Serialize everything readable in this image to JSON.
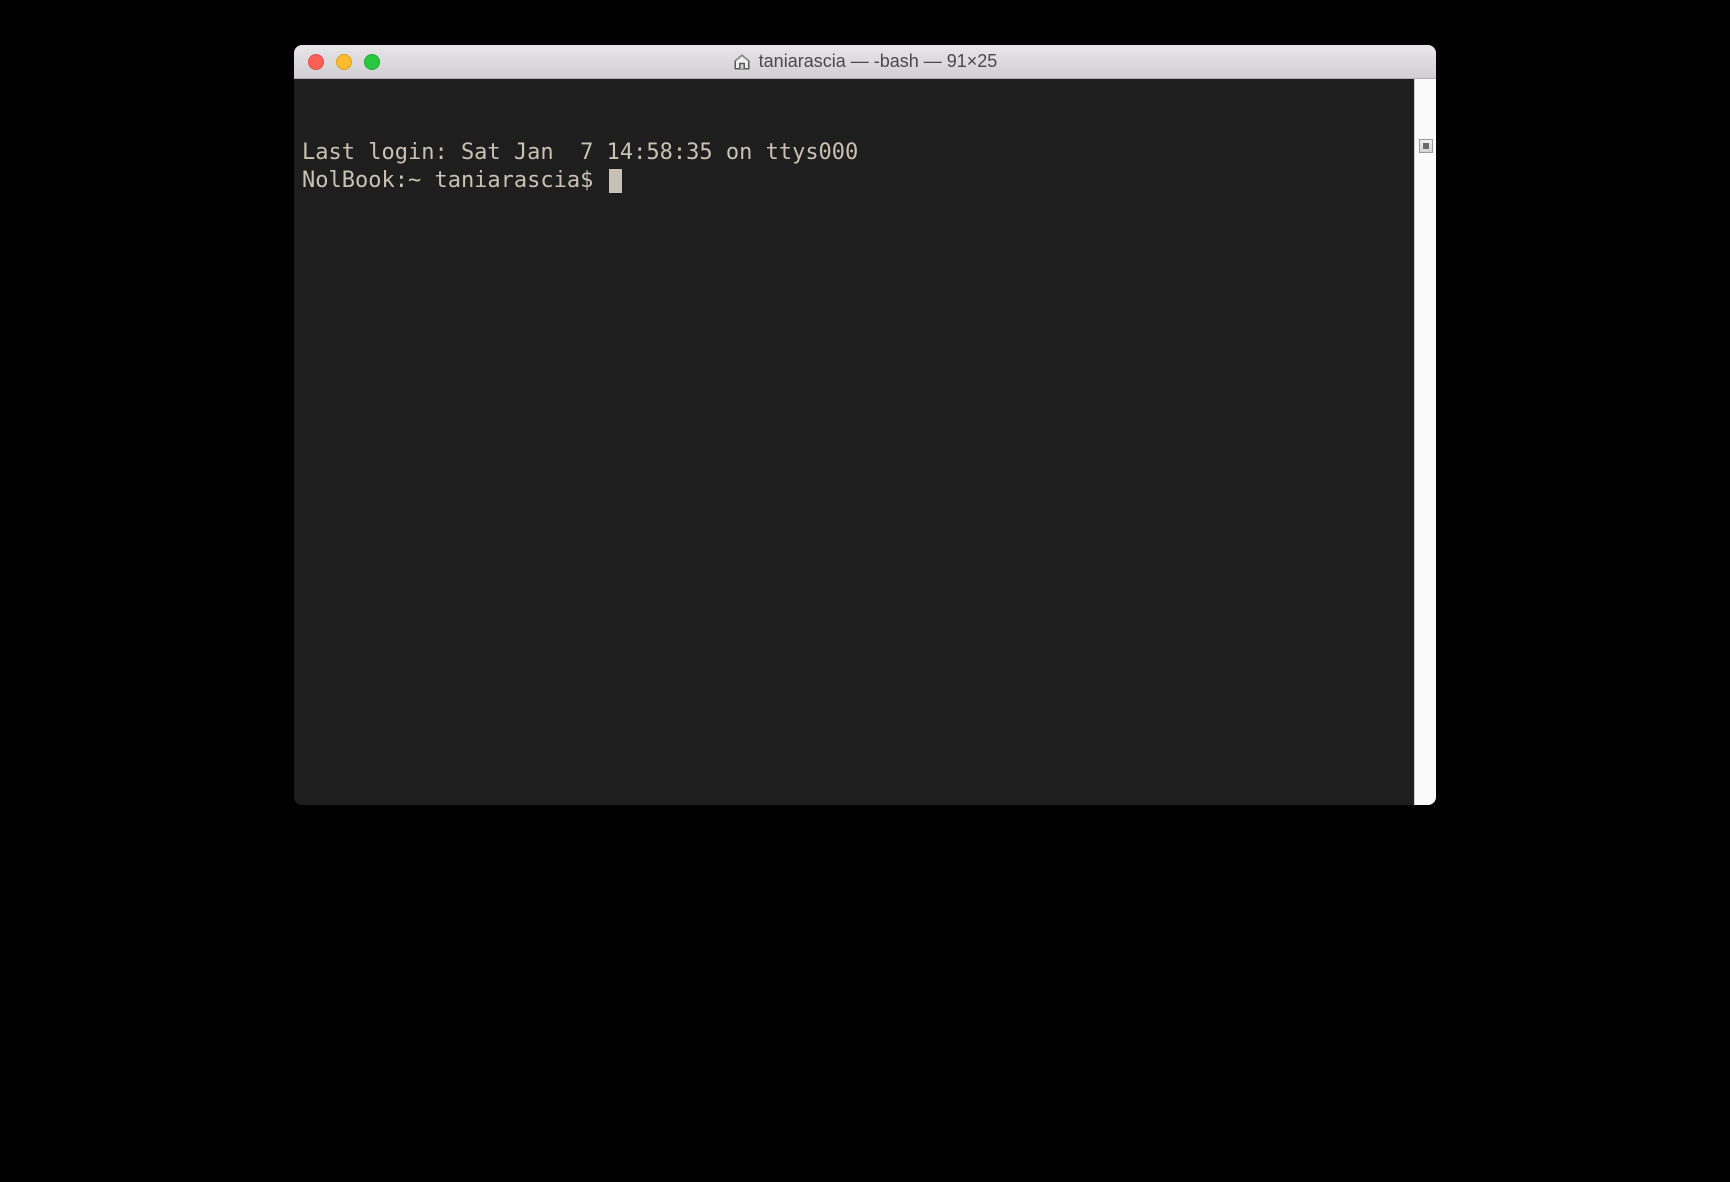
{
  "window": {
    "title": "taniarascia — -bash — 91×25",
    "icon": "home-icon"
  },
  "terminal": {
    "last_login": "Last login: Sat Jan  7 14:58:35 on ttys000",
    "prompt": "NolBook:~ taniarascia$ "
  },
  "colors": {
    "background": "#1e1e1e",
    "foreground": "#c8c1b4",
    "titlebar_gradient_top": "#e8e6e8",
    "titlebar_gradient_bottom": "#d1cfd1",
    "close": "#ff5f57",
    "minimize": "#febc2e",
    "zoom": "#28c840"
  }
}
